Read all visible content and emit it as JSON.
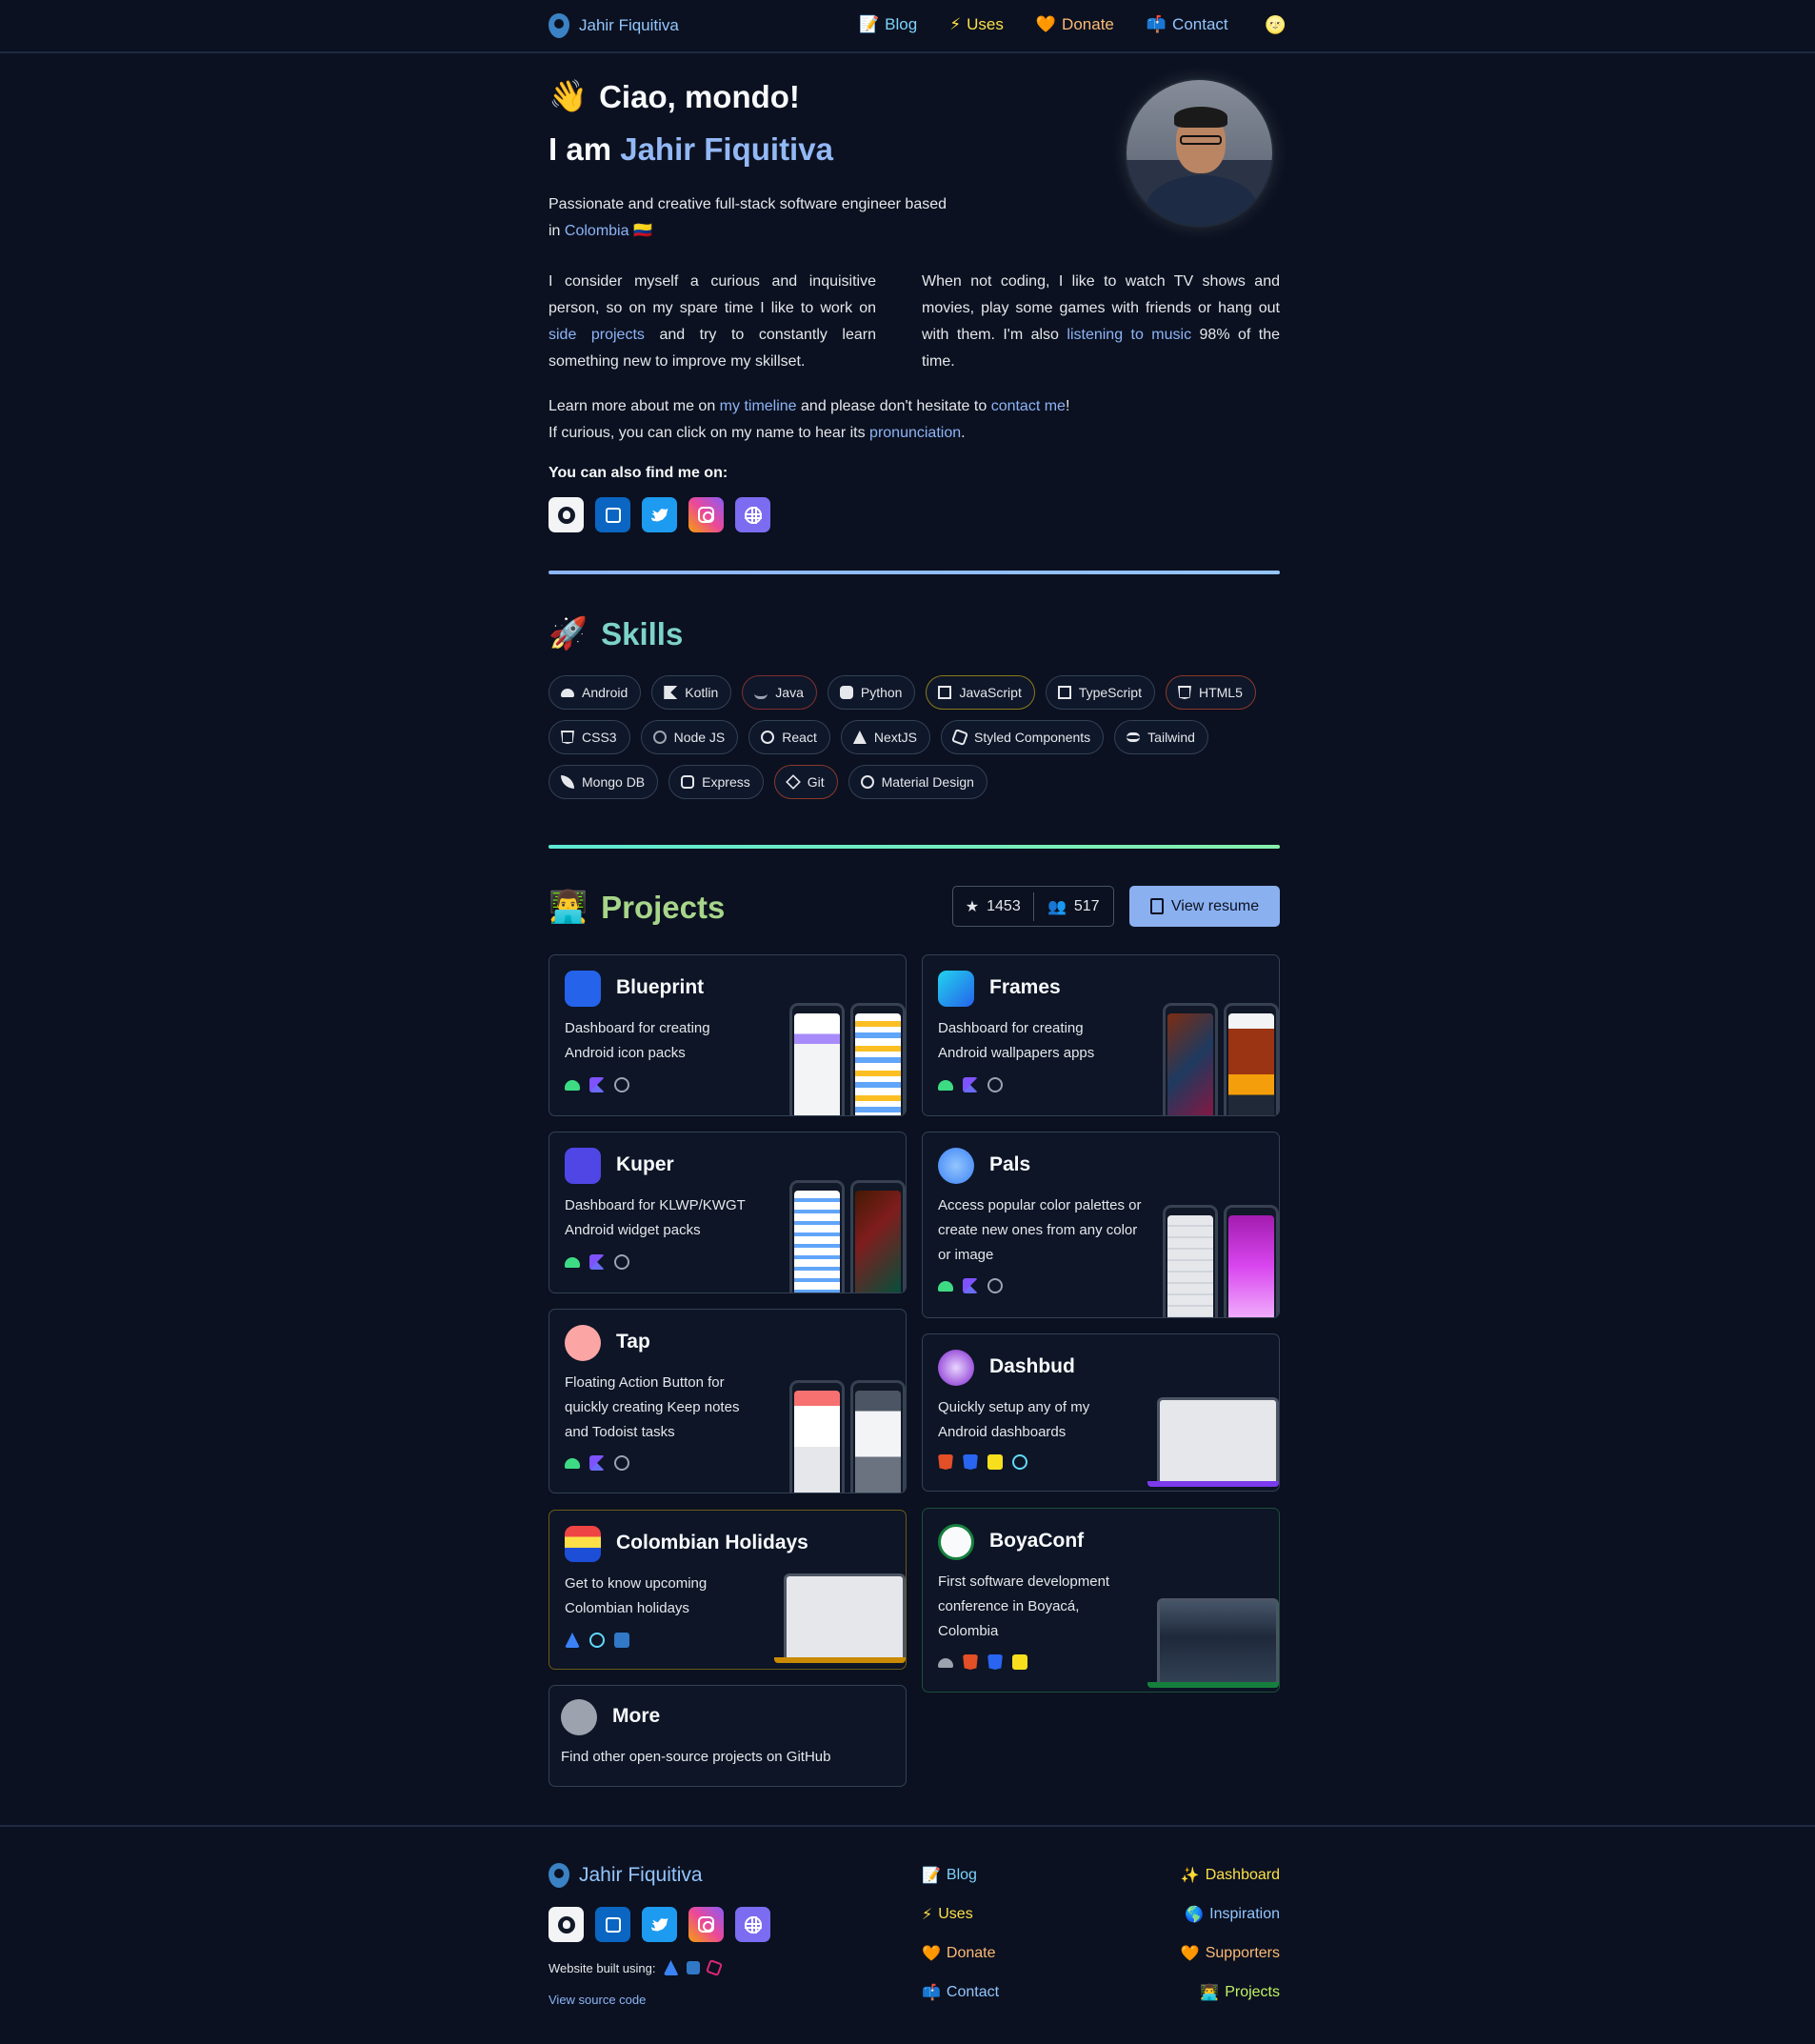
{
  "header": {
    "brand": "Jahir Fiquitiva",
    "nav": [
      {
        "emoji": "📝",
        "label": "Blog"
      },
      {
        "emoji": "⚡",
        "label": "Uses"
      },
      {
        "emoji": "🧡",
        "label": "Donate"
      },
      {
        "emoji": "📫",
        "label": "Contact"
      }
    ],
    "theme_emoji": "🌝"
  },
  "hero": {
    "greeting_emoji": "👋",
    "greeting": "Ciao, mondo!",
    "iam_prefix": "I am",
    "name": "Jahir Fiquitiva",
    "intro_1": "Passionate and creative full-stack software engineer based in",
    "intro_country": "Colombia",
    "intro_flag": "🇨🇴",
    "left_p": [
      "I consider myself a curious and inquisitive person, so on my spare time I like to work on",
      "side projects",
      "and try to constantly learn something new to improve my skillset."
    ],
    "right_p": [
      "When not coding, I like to watch TV shows and movies, play some games with friends or hang out with them. I'm also",
      "listening to music",
      "98% of the time."
    ],
    "more_1": [
      "Learn more about me on",
      "my timeline",
      "and please don't hesitate to",
      "contact me",
      "!"
    ],
    "more_2": [
      "If curious, you can click on my name to hear its",
      "pronunciation",
      "."
    ],
    "find_me": "You can also find me on:"
  },
  "skills": {
    "emoji": "🚀",
    "title": "Skills",
    "items": [
      "Android",
      "Kotlin",
      "Java",
      "Python",
      "JavaScript",
      "TypeScript",
      "HTML5",
      "CSS3",
      "Node JS",
      "React",
      "NextJS",
      "Styled Components",
      "Tailwind",
      "Mongo DB",
      "Express",
      "Git",
      "Material Design"
    ]
  },
  "projects": {
    "emoji": "👨‍💻",
    "title": "Projects",
    "stars": "1453",
    "followers": "517",
    "resume_label": "View resume",
    "cards": [
      {
        "title": "Blueprint",
        "desc": "Dashboard for creating Android icon packs"
      },
      {
        "title": "Frames",
        "desc": "Dashboard for creating Android wallpapers apps"
      },
      {
        "title": "Kuper",
        "desc": "Dashboard for KLWP/KWGT Android widget packs"
      },
      {
        "title": "Pals",
        "desc": "Access popular color palettes or create new ones from any color or image"
      },
      {
        "title": "Tap",
        "desc": "Floating Action Button for quickly creating Keep notes and Todoist tasks"
      },
      {
        "title": "Dashbud",
        "desc": "Quickly setup any of my Android dashboards"
      },
      {
        "title": "Colombian Holidays",
        "desc": "Get to know upcoming Colombian holidays"
      },
      {
        "title": "BoyaConf",
        "desc": "First software development conference in Boyacá, Colombia"
      },
      {
        "title": "More",
        "desc": "Find other open-source projects on GitHub"
      }
    ]
  },
  "footer": {
    "brand": "Jahir Fiquitiva",
    "built_using": "Website built using:",
    "source": "View source code",
    "col1": [
      {
        "emoji": "📝",
        "label": "Blog"
      },
      {
        "emoji": "⚡",
        "label": "Uses"
      },
      {
        "emoji": "🧡",
        "label": "Donate"
      },
      {
        "emoji": "📫",
        "label": "Contact"
      }
    ],
    "col2": [
      {
        "emoji": "✨",
        "label": "Dashboard"
      },
      {
        "emoji": "🌎",
        "label": "Inspiration"
      },
      {
        "emoji": "🧡",
        "label": "Supporters"
      },
      {
        "emoji": "👨‍💻",
        "label": "Projects"
      }
    ]
  },
  "colors": {
    "background": "#0b1120",
    "accent": "#8db4f7",
    "skills_title": "#7dd3c8",
    "projects_title": "#a7d58a"
  }
}
